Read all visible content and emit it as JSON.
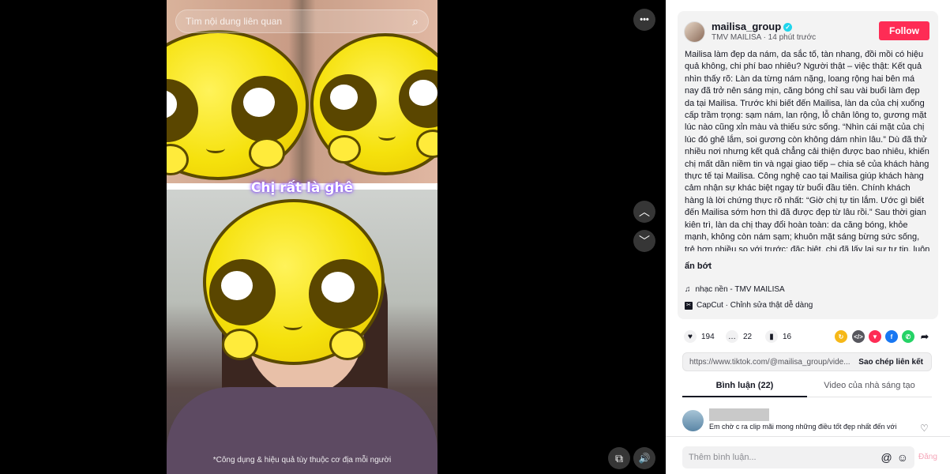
{
  "search": {
    "placeholder": "Tìm nội dung liên quan",
    "icon": "search-icon"
  },
  "video": {
    "caption": "Chị rất là ghê",
    "disclaimer": "*Công dụng & hiệu quả tùy thuộc cơ địa mỗi người"
  },
  "controls": {
    "more_icon": "•••",
    "up_icon": "︿",
    "down_icon": "﹀",
    "pip_icon": "⧉",
    "volume_icon": "🔊"
  },
  "author": {
    "username": "mailisa_group",
    "subtitle": "TMV MAILISA · 14 phút trước",
    "follow_label": "Follow"
  },
  "description": "Mailisa làm đẹp da nám, da sắc tố, tàn nhang, đồi mồi có hiệu quả không, chi phí bao nhiêu? Người thật – việc thật: Kết quả nhìn thấy rõ: Làn da từng nám nặng, loang rộng hai bên má nay đã trở nên sáng mịn, căng bóng chỉ sau vài buổi làm đẹp da tại Mailisa. Trước khi biết đến Mailisa, làn da của chị xuống cấp trầm trọng: sạm nám, lan rộng, lỗ chân lông to, gương mặt lúc nào cũng xỉn màu và thiếu sức sống. “Nhìn cái mặt của chị lúc đó ghê lắm, soi gương còn không dám nhìn lâu.” Dù đã thử nhiều nơi nhưng kết quả chẳng cải thiện được bao nhiêu, khiến chị mất dần niềm tin và ngại giao tiếp – chia sẻ của khách hàng thực tế tại Mailisa. Công nghệ cao tại Mailisa giúp khách hàng cảm nhận sự khác biệt ngay từ buổi đầu tiên. Chính khách hàng là lời chứng thực rõ nhất: “Giờ chị tự tin lắm. Ước gì biết đến Mailisa sớm hơn thì đã được đẹp từ lâu rồi.” Sau thời gian kiên trì, làn da chị thay đổi hoàn toàn: da căng bóng, khỏe mạnh, không còn nám sạm; khuôn mặt sáng bừng sức sống, trẻ hơn nhiều so với trước; đặc biệt, chị đã lấy lại sự tự tin, luôn vui vẻ khi nhìn mình trong gương. Hai công nghệ độc quyền tại Mailisa",
  "less_label": "ẩn bớt",
  "music": "nhạc nền - TMV MAILISA",
  "capcut": "CapCut · Chỉnh sửa thật dễ dàng",
  "stats": {
    "likes": "194",
    "comments": "22",
    "saves": "16"
  },
  "link": {
    "url": "https://www.tiktok.com/@mailisa_group/vide...",
    "copy_label": "Sao chép liên kết"
  },
  "tabs": [
    {
      "label": "Bình luận (22)"
    },
    {
      "label": "Video của nhà sáng tạo"
    }
  ],
  "comments": [
    {
      "text": "Em chờ c ra clip mãi mong những điều tốt đẹp nhất đến với"
    }
  ],
  "comment_input": {
    "placeholder": "Thêm bình luận...",
    "post_label": "Đăng"
  }
}
